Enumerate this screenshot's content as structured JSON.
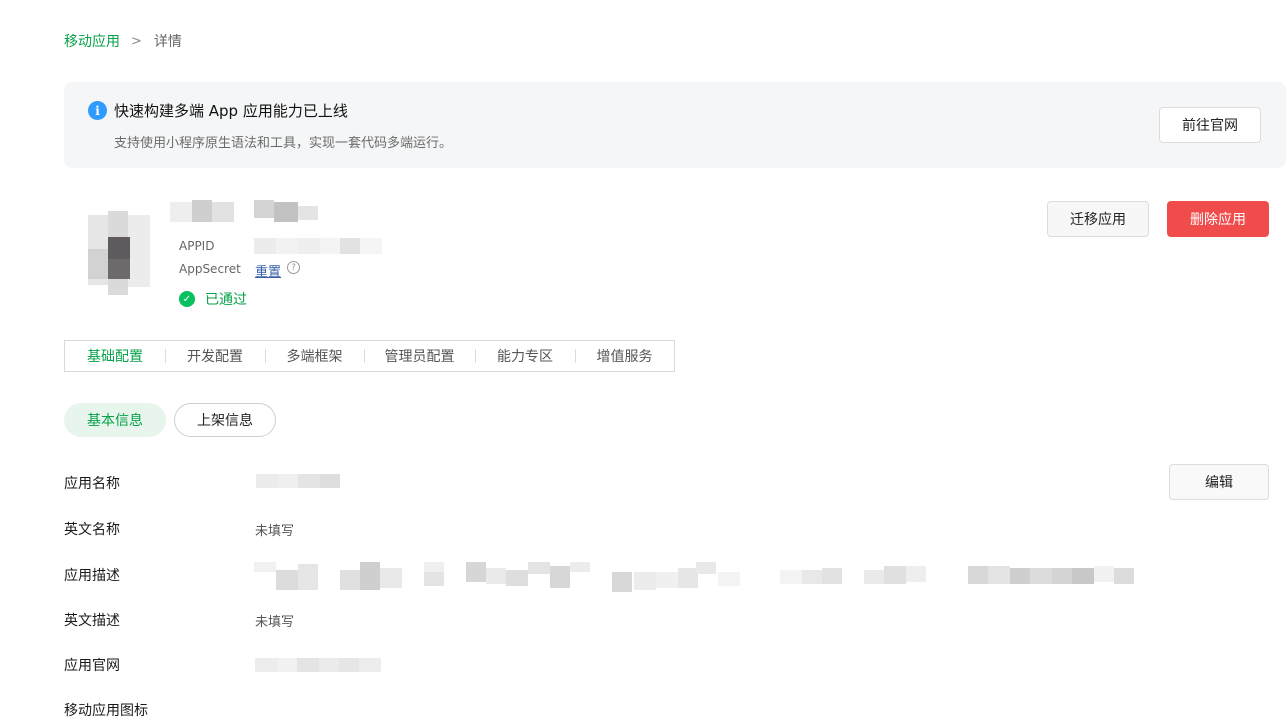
{
  "breadcrumb": {
    "parent": "移动应用",
    "separator": ">",
    "current": "详情"
  },
  "notice": {
    "icon": "info-icon",
    "title": "快速构建多端 App 应用能力已上线",
    "description": "支持使用小程序原生语法和工具，实现一套代码多端运行。",
    "button": "前往官网"
  },
  "app": {
    "appid_label": "APPID",
    "appsecret_label": "AppSecret",
    "reset_label": "重置",
    "help_glyph": "?",
    "status_text": "已通过",
    "status_color": "#07a14a",
    "migrate_button": "迁移应用",
    "delete_button": "删除应用",
    "delete_color": "#f04c4c"
  },
  "tabs": [
    "基础配置",
    "开发配置",
    "多端框架",
    "管理员配置",
    "能力专区",
    "增值服务"
  ],
  "subtabs": {
    "basic": "基本信息",
    "listing": "上架信息"
  },
  "fields": {
    "app_name": "应用名称",
    "en_name": "英文名称",
    "en_name_value": "未填写",
    "app_desc": "应用描述",
    "en_desc": "英文描述",
    "en_desc_value": "未填写",
    "website": "应用官网",
    "icon": "移动应用图标"
  },
  "edit_button": "编辑",
  "accent_color": "#07a14a"
}
